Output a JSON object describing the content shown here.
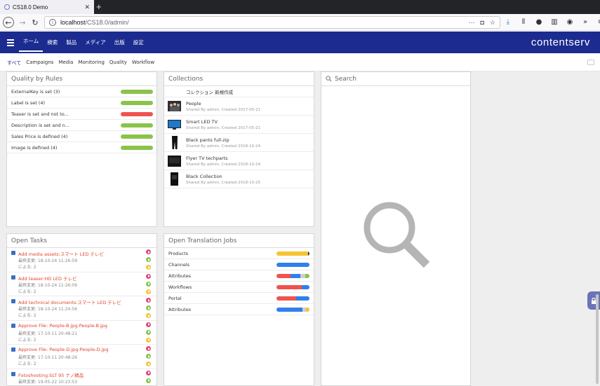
{
  "browser": {
    "tab_title": "CS18.0 Demo",
    "url_host": "localhost",
    "url_path": "/CS18.0/admin/"
  },
  "app": {
    "brand": "contentserv",
    "main_nav": [
      "ホーム",
      "検索",
      "製品",
      "メディア",
      "出版",
      "設定"
    ],
    "sub_nav": [
      "すべて",
      "Campaigns",
      "Media",
      "Monitoring",
      "Quality",
      "Workflow"
    ]
  },
  "colors": {
    "header": "#1c2b8f",
    "green": "#8bc34a",
    "red": "#ef5350",
    "blue": "#2f80ed",
    "yellow": "#f5c431",
    "grey": "#cfcfcf"
  },
  "quality": {
    "title": "Quality by Rules",
    "rows": [
      {
        "label": "ExternalKey is set (3)",
        "status": "green"
      },
      {
        "label": "Label is set (4)",
        "status": "green"
      },
      {
        "label": "Teaser is set and not to...",
        "status": "red"
      },
      {
        "label": "Description is set and n...",
        "status": "green"
      },
      {
        "label": "Sales Price is defined (4)",
        "status": "green"
      },
      {
        "label": "Image is defined (4)",
        "status": "green"
      }
    ]
  },
  "collections": {
    "title": "Collections",
    "new_label": "コレクション 新規作成",
    "items": [
      {
        "name": "People",
        "meta": "Shared By admin, Created 2017-05-21",
        "thumb": "people-photo-icon"
      },
      {
        "name": "Smart LED TV",
        "meta": "Shared By admin, Created 2017-05-21",
        "thumb": "tv-icon"
      },
      {
        "name": "Black pants full-zip",
        "meta": "Shared By admin, Created 2018-10-24",
        "thumb": "pants-icon"
      },
      {
        "name": "Flyer TV techparts",
        "meta": "Shared By admin, Created 2018-10-24",
        "thumb": "flyer-icon"
      },
      {
        "name": "Black Collection",
        "meta": "Shared By admin, Created 2018-10-25",
        "thumb": "black-collection-icon"
      }
    ]
  },
  "search": {
    "title": "Search"
  },
  "tasks": {
    "title": "Open Tasks",
    "items": [
      {
        "title": "Add media assets:スマート LED テレビ",
        "changed": "最終変更: 18-10-24 11:26:59",
        "by": "による: 2"
      },
      {
        "title": "Add teaser:HD LED テレビ",
        "changed": "最終変更: 18-10-24 11:26:09",
        "by": "による: 2"
      },
      {
        "title": "Add technical documents:スマート LED テレビ",
        "changed": "最終変更: 18-10-24 11:24:56",
        "by": "による: 2"
      },
      {
        "title": "Approve File: People-B.jpg:People-B.jpg",
        "changed": "最終変更: 17-10-11 20:48:21",
        "by": "による: 2"
      },
      {
        "title": "Approve File: People-D.jpg:People-D.jpg",
        "changed": "最終変更: 17-10-11 20:48:26",
        "by": "による: 2"
      },
      {
        "title": "Fotoshooting:SLT 95 ナノ精品",
        "changed": "最終変更: 19-05-22 10:23:53",
        "by": ""
      }
    ]
  },
  "translation": {
    "title": "Open Translation Jobs",
    "rows": [
      {
        "label": "Products",
        "segments": [
          {
            "color": "yellow",
            "share": 0.96
          },
          {
            "color": "dark",
            "share": 0.04
          }
        ]
      },
      {
        "label": "Channels",
        "segments": [
          {
            "color": "blue",
            "share": 1.0
          }
        ]
      },
      {
        "label": "Attributes",
        "segments": [
          {
            "color": "red",
            "share": 0.42
          },
          {
            "color": "blue",
            "share": 0.3
          },
          {
            "color": "grey",
            "share": 0.16
          },
          {
            "color": "green",
            "share": 0.12
          }
        ]
      },
      {
        "label": "Workflows",
        "segments": [
          {
            "color": "red",
            "share": 0.76
          },
          {
            "color": "blue",
            "share": 0.24
          }
        ]
      },
      {
        "label": "Portal",
        "segments": [
          {
            "color": "red",
            "share": 0.6
          },
          {
            "color": "blue",
            "share": 0.4
          }
        ]
      },
      {
        "label": "Attributes",
        "segments": [
          {
            "color": "blue",
            "share": 0.78
          },
          {
            "color": "grey",
            "share": 0.12
          },
          {
            "color": "yellow",
            "share": 0.1
          }
        ]
      }
    ]
  }
}
